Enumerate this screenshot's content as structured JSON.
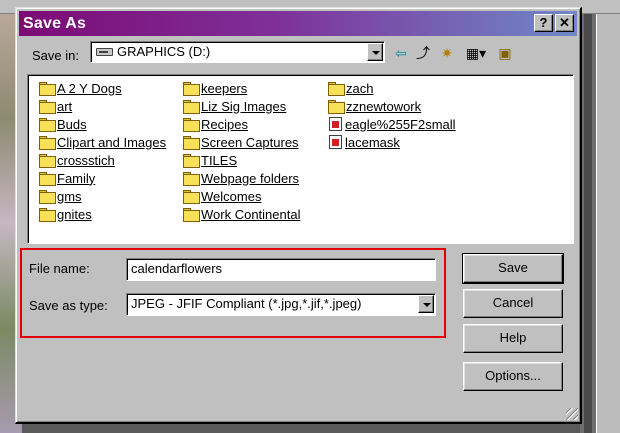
{
  "dialog": {
    "title": "Save As",
    "help_label": "?",
    "close_label": "✕"
  },
  "save_in": {
    "label": "Save in:",
    "value": "GRAPHICS (D:)"
  },
  "toolbar": {
    "back_glyph": "⇦",
    "up_glyph": "⤴",
    "new_folder_glyph": "✷",
    "view_menu_glyph": "▦▾",
    "favorites_glyph": "▣"
  },
  "files": {
    "col1": [
      {
        "name": "A 2 Y Dogs",
        "type": "folder"
      },
      {
        "name": "art",
        "type": "folder"
      },
      {
        "name": "Buds",
        "type": "folder"
      },
      {
        "name": "Clipart and Images",
        "type": "folder"
      },
      {
        "name": "crossstich",
        "type": "folder"
      },
      {
        "name": "Family",
        "type": "folder"
      },
      {
        "name": "gms",
        "type": "folder"
      },
      {
        "name": "gnites",
        "type": "folder"
      }
    ],
    "col2": [
      {
        "name": "keepers",
        "type": "folder"
      },
      {
        "name": "Liz Sig Images",
        "type": "folder"
      },
      {
        "name": "Recipes",
        "type": "folder"
      },
      {
        "name": "Screen Captures",
        "type": "folder"
      },
      {
        "name": "TILES",
        "type": "folder"
      },
      {
        "name": "Webpage folders",
        "type": "folder"
      },
      {
        "name": "Welcomes",
        "type": "folder"
      },
      {
        "name": "Work Continental",
        "type": "folder"
      }
    ],
    "col3": [
      {
        "name": "zach",
        "type": "folder"
      },
      {
        "name": "zznewtowork",
        "type": "folder"
      },
      {
        "name": "eagle%255F2small",
        "type": "image"
      },
      {
        "name": "lacemask",
        "type": "image"
      }
    ]
  },
  "file_name": {
    "label": "File name:",
    "value": "calendarflowers"
  },
  "save_as_type": {
    "label": "Save as type:",
    "value": "JPEG - JFIF Compliant (*.jpg,*.jif,*.jpeg)"
  },
  "buttons": {
    "save": "Save",
    "cancel": "Cancel",
    "help": "Help",
    "options": "Options..."
  },
  "colors": {
    "title_gradient_start": "#7d0a75",
    "title_gradient_end": "#6f88c8",
    "highlight_frame": "#e00000"
  }
}
